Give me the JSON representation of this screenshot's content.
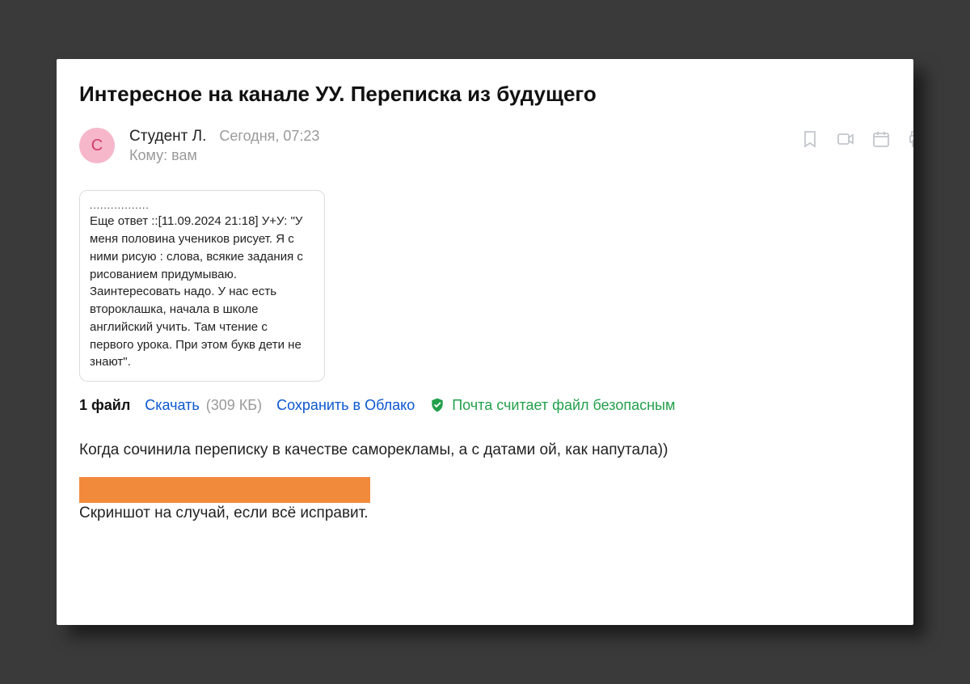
{
  "subject": "Интересное на канале УУ. Переписка из будущего",
  "avatar_glyph": "С",
  "sender": {
    "name": "Студент Л.",
    "time": "Сегодня, 07:23",
    "recipient_prefix": "Кому:",
    "recipient": "вам"
  },
  "quote": {
    "dots": ".................",
    "text": "Еще ответ ::[11.09.2024 21:18] У+У: \"У меня половина учеников рисует. Я с ними рисую : слова, всякие задания с рисованием придумываю. Заинтересовать надо. У нас есть второклашка, начала в школе английский учить. Там чтение с первого урока. При этом букв дети не знают\"."
  },
  "attachments": {
    "count_label": "1 файл",
    "download": "Скачать",
    "size": "(309 КБ)",
    "save_cloud": "Сохранить в Облако",
    "safe_text": "Почта считает файл безопасным"
  },
  "body_line1": "Когда сочинила переписку в качестве саморекламы, а с датами ой, как напутала))",
  "body_line2": "Скриншот на случай, если всё исправит.",
  "colors": {
    "redaction": "#f28a3c",
    "link": "#0b57d0",
    "safe": "#22a04b",
    "avatar_bg": "#f6b7cb",
    "avatar_fg": "#d13a6b"
  }
}
